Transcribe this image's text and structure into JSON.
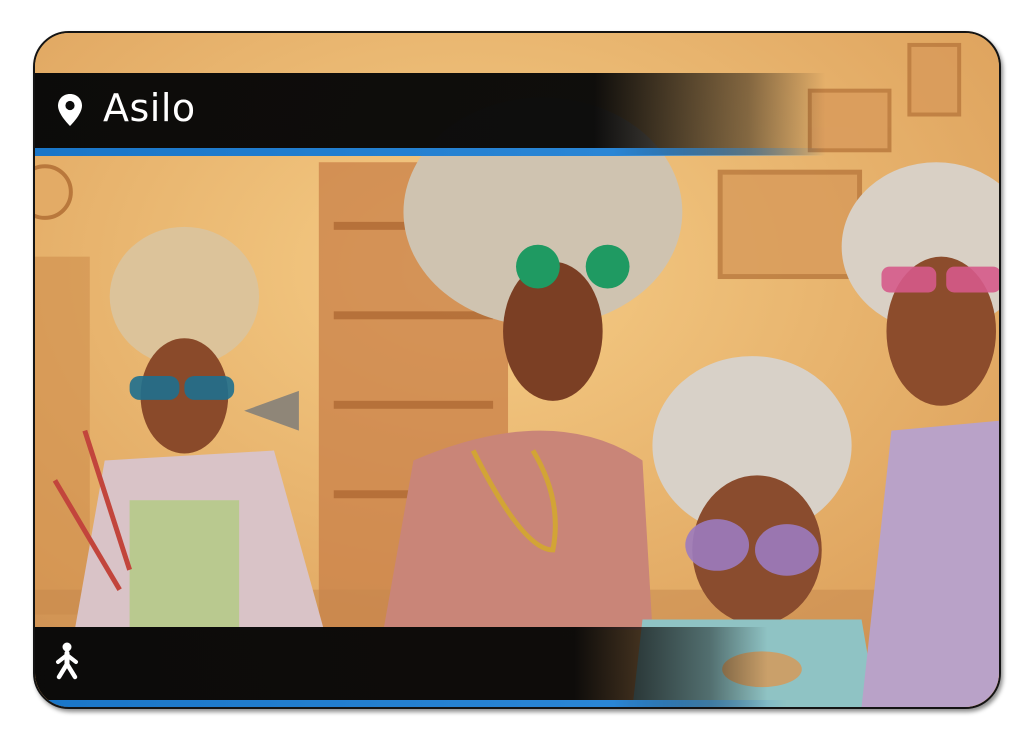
{
  "card": {
    "location_name": "Asilo",
    "location_icon": "map-pin-icon",
    "movement_icon": "walking-person-icon"
  },
  "colors": {
    "banner": "#080808",
    "stripe": "#1a76c8",
    "wall": "#eab56a",
    "text": "#ffffff"
  }
}
